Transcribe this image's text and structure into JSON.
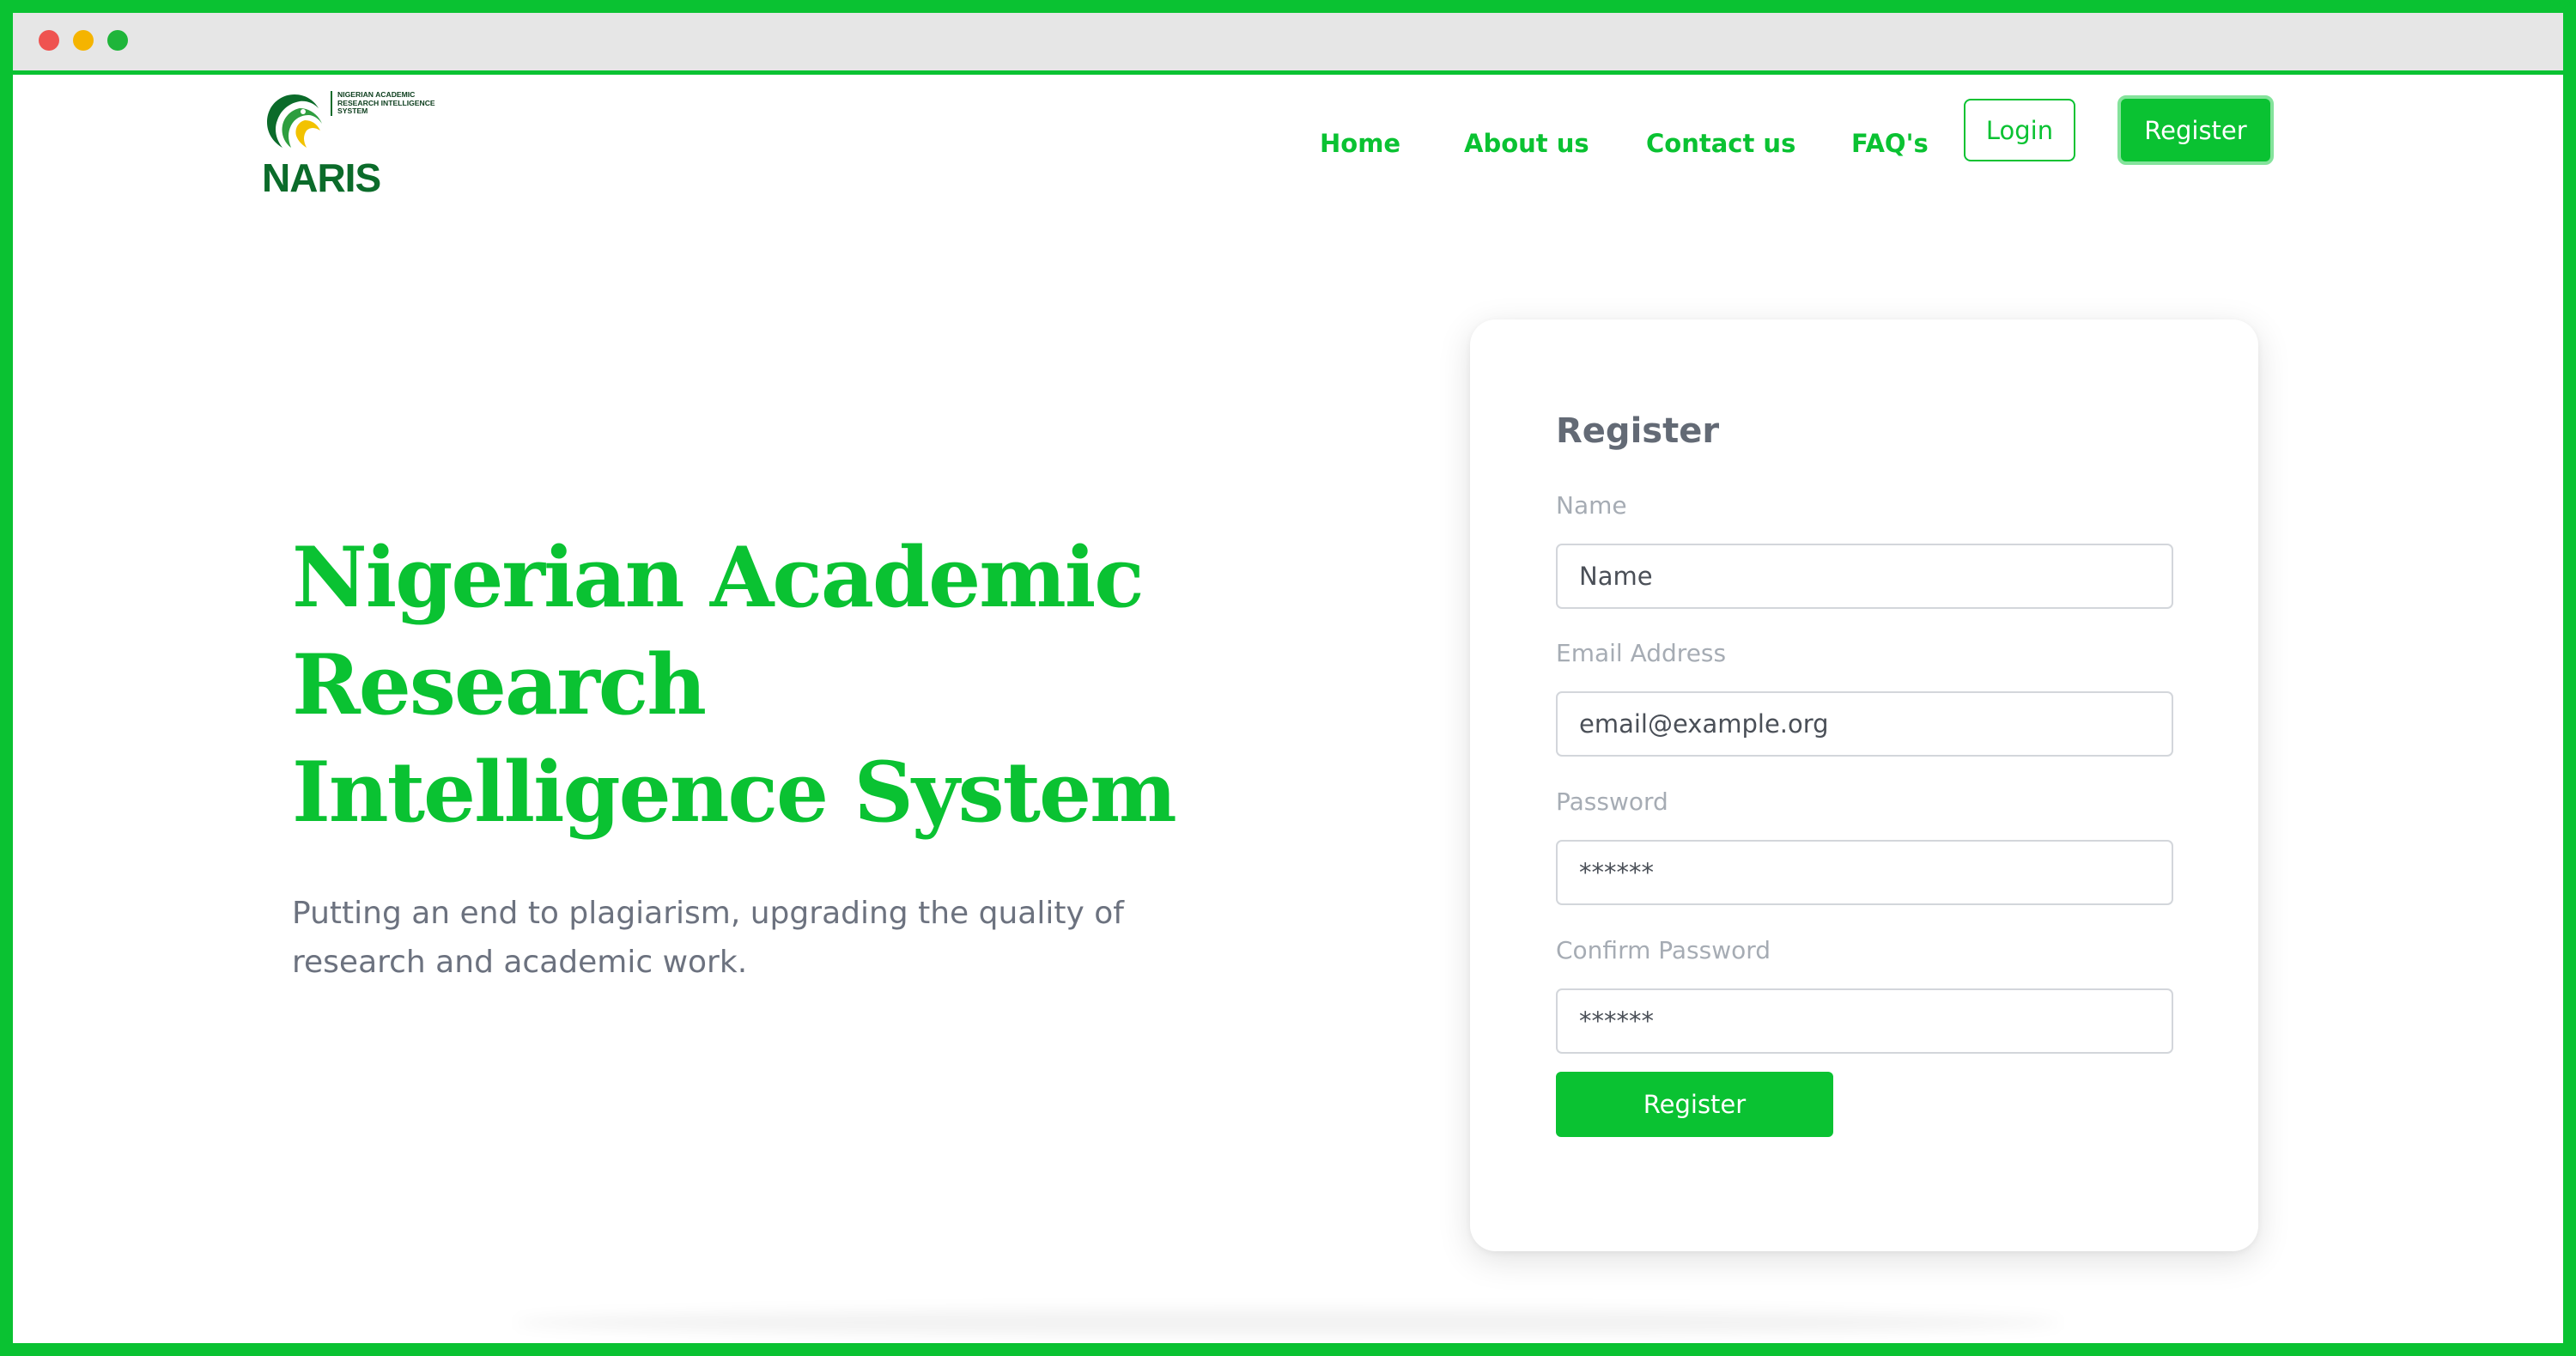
{
  "window": {
    "controls": [
      "close",
      "minimize",
      "maximize"
    ]
  },
  "brand": {
    "logo_text": "NARIS",
    "logo_subtext": "NIGERIAN ACADEMIC RESEARCH INTELLIGENCE SYSTEM",
    "accent_color": "#0ac232",
    "logo_color": "#0b6b2a"
  },
  "nav": {
    "links": [
      {
        "label": "Home"
      },
      {
        "label": "About us"
      },
      {
        "label": "Contact us"
      },
      {
        "label": "FAQ's"
      }
    ],
    "login_label": "Login",
    "register_label": "Register"
  },
  "hero": {
    "title_line1": "Nigerian Academic",
    "title_line2": "Research",
    "title_line3": "Intelligence System",
    "subtitle": "Putting an end to plagiarism, upgrading the quality of research and academic work."
  },
  "register_form": {
    "title": "Register",
    "fields": [
      {
        "label": "Name",
        "placeholder": "Name",
        "type": "text"
      },
      {
        "label": "Email Address",
        "placeholder": "email@example.org",
        "type": "email"
      },
      {
        "label": "Password",
        "placeholder": "******",
        "type": "password"
      },
      {
        "label": "Confirm Password",
        "placeholder": "******",
        "type": "password"
      }
    ],
    "submit_label": "Register"
  }
}
